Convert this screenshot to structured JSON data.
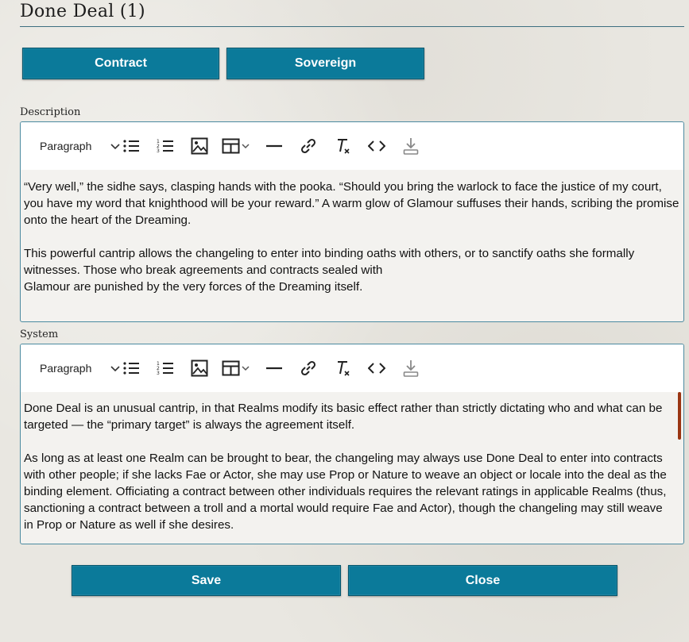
{
  "header": {
    "title": "Done Deal (1)"
  },
  "tabs": {
    "contract_label": "Contract",
    "sovereign_label": "Sovereign"
  },
  "description": {
    "label": "Description",
    "format_select": "Paragraph",
    "paragraphs": [
      "“Very well,” the sidhe says, clasping hands with the pooka. “Should you bring the warlock to face the justice of my court, you have my word that knighthood will be your reward.” A warm glow of Glamour suffuses their hands, scribing the promise onto the heart of the Dreaming.",
      "This powerful cantrip allows the changeling to enter into binding oaths with others, or to sanctify oaths she formally witnesses. Those who break agreements and contracts sealed with",
      "Glamour are punished by the very forces of the Dreaming itself."
    ]
  },
  "system": {
    "label": "System",
    "format_select": "Paragraph",
    "paragraphs": [
      "Done Deal is an unusual cantrip, in that Realms modify its basic effect rather than strictly dictating who and what can be targeted — the “primary target” is always the agreement itself.",
      "As long as at least one Realm can be brought to bear, the changeling may always use Done Deal to enter into contracts with other people; if she lacks Fae or Actor, she may use Prop or Nature to weave an object or locale into the deal as the binding element. Officiating a contract between other individuals requires the relevant ratings in applicable Realms (thus, sanctioning a contract between a troll and a mortal would require Fae and Actor), though the changeling may still weave in Prop or Nature as well if she desires."
    ]
  },
  "footer": {
    "save_label": "Save",
    "close_label": "Close"
  },
  "colors": {
    "accent": "#0b7a9a",
    "rule": "#3d6f80",
    "scrollbar": "#9a3512"
  }
}
